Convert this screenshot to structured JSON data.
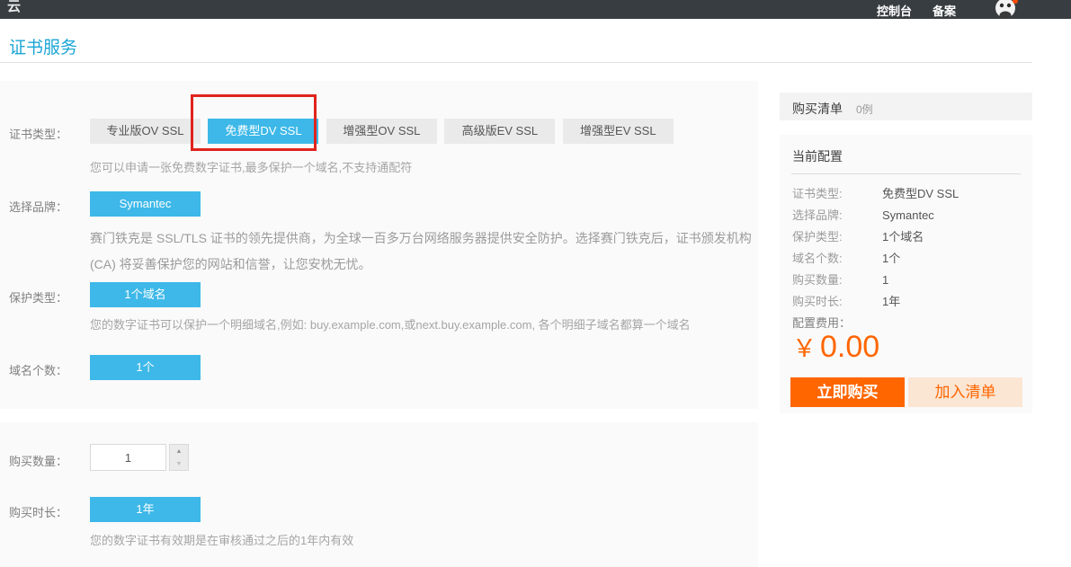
{
  "topbar": {
    "logo": "云",
    "console_link": "控制台",
    "beian_link": "备案"
  },
  "page": {
    "title": "证书服务"
  },
  "form": {
    "cert_type": {
      "label": "证书类型：",
      "tabs": [
        "专业版OV SSL",
        "免费型DV SSL",
        "增强型OV SSL",
        "高级版EV SSL",
        "增强型EV SSL"
      ],
      "active_tab": "免费型DV SSL",
      "description": "您可以申请一张免费数字证书,最多保护一个域名,不支持通配符"
    },
    "brand": {
      "label": "选择品牌：",
      "value": "Symantec",
      "description": "赛门铁克是 SSL/TLS 证书的领先提供商，为全球一百多万台网络服务器提供安全防护。选择赛门铁克后，证书颁发机构 (CA) 将妥善保护您的网站和信誉，让您安枕无忧。"
    },
    "protect_type": {
      "label": "保护类型：",
      "value": "1个域名",
      "description": "您的数字证书可以保护一个明细域名,例如: buy.example.com,或next.buy.example.com, 各个明细子域名都算一个域名"
    },
    "domain_count": {
      "label": "域名个数：",
      "value": "1个"
    },
    "quantity": {
      "label": "购买数量：",
      "value": "1"
    },
    "duration": {
      "label": "购买时长：",
      "value": "1年",
      "description": "您的数字证书有效期是在审核通过之后的1年内有效"
    }
  },
  "cart": {
    "title": "购买清单",
    "count": "0例"
  },
  "summary": {
    "title": "当前配置",
    "rows": [
      {
        "label": "证书类型:",
        "value": "免费型DV SSL"
      },
      {
        "label": "选择品牌:",
        "value": "Symantec"
      },
      {
        "label": "保护类型:",
        "value": "1个域名"
      },
      {
        "label": "域名个数:",
        "value": "1个"
      },
      {
        "label": "购买数量:",
        "value": "1"
      },
      {
        "label": "购买时长:",
        "value": "1年"
      }
    ],
    "fee_label": "配置费用：",
    "currency": "￥",
    "amount": "0.00",
    "buy_button": "立即购买",
    "add_button": "加入清单"
  },
  "colors": {
    "topbar_bg": "#373d41",
    "title_blue": "#1ca6d6",
    "accent_blue": "#3db8e8",
    "price_orange": "#ff6600",
    "add_button_bg": "#fbe5d3",
    "annotation_red": "#e0231d",
    "section_bg": "#fafafa"
  }
}
